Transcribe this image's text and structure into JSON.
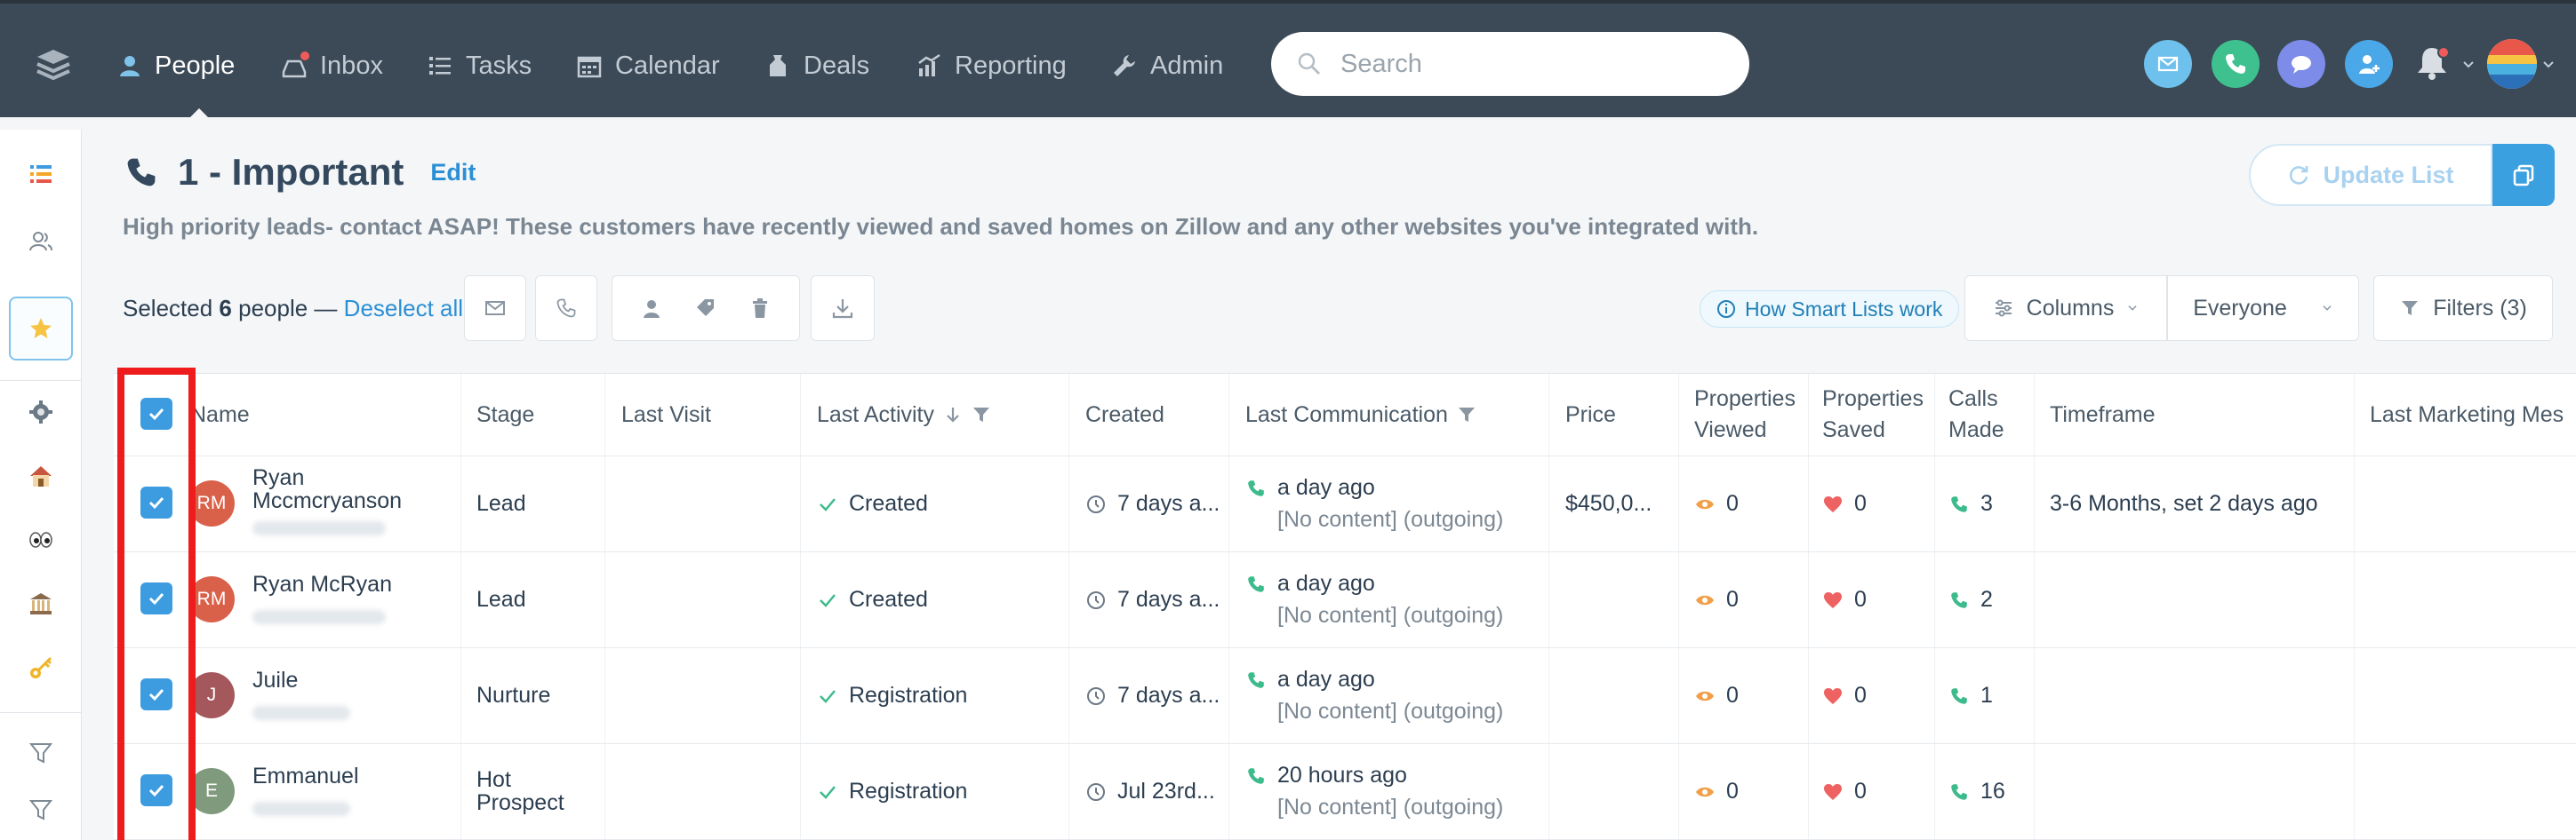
{
  "nav": {
    "items": [
      {
        "label": "People",
        "icon": "person-icon"
      },
      {
        "label": "Inbox",
        "icon": "inbox-icon"
      },
      {
        "label": "Tasks",
        "icon": "list-icon"
      },
      {
        "label": "Calendar",
        "icon": "calendar-icon"
      },
      {
        "label": "Deals",
        "icon": "deals-icon"
      },
      {
        "label": "Reporting",
        "icon": "chart-icon"
      },
      {
        "label": "Admin",
        "icon": "wrench-icon"
      }
    ],
    "active": "People",
    "search_placeholder": "Search"
  },
  "header": {
    "title": "1 - Important",
    "edit": "Edit",
    "description": "High priority leads- contact ASAP! These customers have recently viewed and saved homes on Zillow and any other websites you've integrated with.",
    "update_list": "Update List"
  },
  "selection": {
    "prefix": "Selected",
    "count": "6",
    "suffix": "people —",
    "deselect": "Deselect all"
  },
  "toolbar_right": {
    "smart_lists": "How Smart Lists work",
    "columns": "Columns",
    "everyone": "Everyone",
    "filters": "Filters (3)"
  },
  "columns": {
    "name": "Name",
    "stage": "Stage",
    "last_visit": "Last Visit",
    "last_activity": "Last Activity",
    "created": "Created",
    "last_communication": "Last Communication",
    "price": "Price",
    "properties_viewed": "Properties Viewed",
    "properties_saved": "Properties Saved",
    "calls_made": "Calls Made",
    "timeframe": "Timeframe",
    "last_marketing": "Last Marketing Mes"
  },
  "rows": [
    {
      "initials": "RM",
      "avatar_color": "#d9614a",
      "name": "Ryan Mccmcryanson",
      "stage": "Lead",
      "last_visit": "",
      "activity": "Created",
      "created": "7 days a...",
      "comm_time": "a day ago",
      "comm_detail": "[No content] (outgoing)",
      "price": "$450,0...",
      "viewed": "0",
      "saved": "0",
      "calls": "3",
      "timeframe": "3-6 Months, set 2 days ago"
    },
    {
      "initials": "RM",
      "avatar_color": "#d9614a",
      "name": "Ryan McRyan",
      "stage": "Lead",
      "last_visit": "",
      "activity": "Created",
      "created": "7 days a...",
      "comm_time": "a day ago",
      "comm_detail": "[No content] (outgoing)",
      "price": "",
      "viewed": "0",
      "saved": "0",
      "calls": "2",
      "timeframe": ""
    },
    {
      "initials": "J",
      "avatar_color": "#a4585c",
      "name": "Juile",
      "stage": "Nurture",
      "last_visit": "",
      "activity": "Registration",
      "created": "7 days a...",
      "comm_time": "a day ago",
      "comm_detail": "[No content] (outgoing)",
      "price": "",
      "viewed": "0",
      "saved": "0",
      "calls": "1",
      "timeframe": ""
    },
    {
      "initials": "E",
      "avatar_color": "#7f9a7c",
      "name": "Emmanuel",
      "stage": "Hot Prospect",
      "last_visit": "",
      "activity": "Registration",
      "created": "Jul 23rd...",
      "comm_time": "20 hours ago",
      "comm_detail": "[No content] (outgoing)",
      "price": "",
      "viewed": "0",
      "saved": "0",
      "calls": "16",
      "timeframe": ""
    }
  ],
  "colors": {
    "topbar": "#3c4a57",
    "accent": "#3d9be0",
    "check_green": "#3dbb8c",
    "heart": "#ef6262",
    "eye": "#f0a04b",
    "highlight": "#ee1c1c"
  }
}
